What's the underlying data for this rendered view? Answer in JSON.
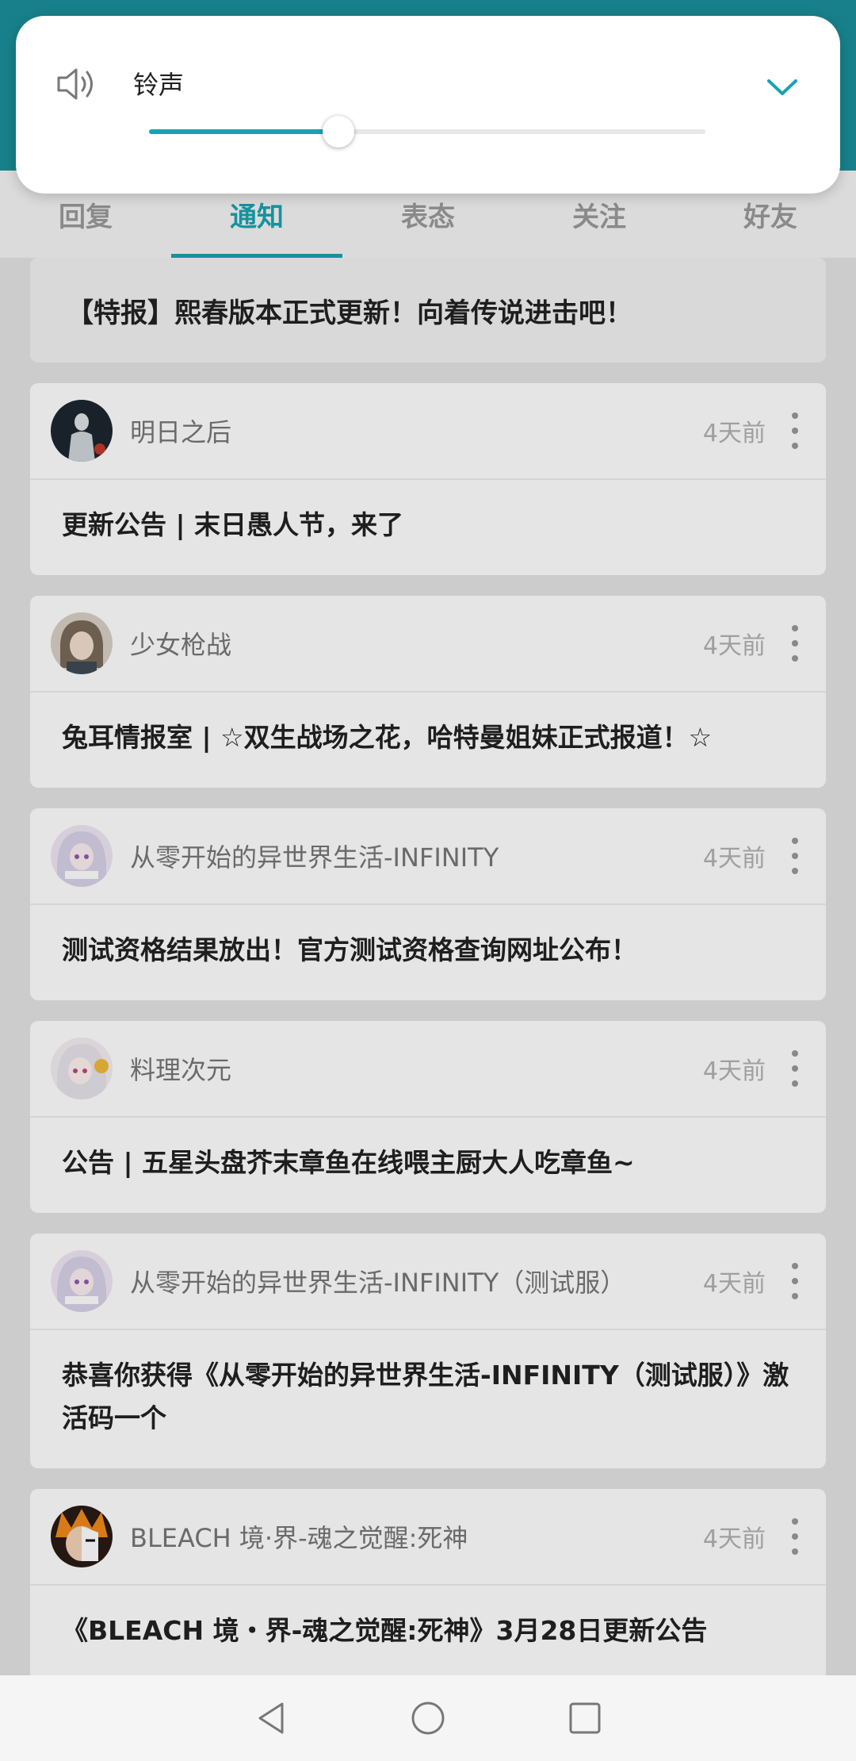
{
  "volume": {
    "label": "铃声",
    "level": 0.34,
    "accent": "#19a3b2",
    "icon": "speaker-icon",
    "expand_icon": "chevron-down-icon"
  },
  "tabs": [
    {
      "label": "回复",
      "active": false
    },
    {
      "label": "通知",
      "active": true
    },
    {
      "label": "表态",
      "active": false
    },
    {
      "label": "关注",
      "active": false
    },
    {
      "label": "好友",
      "active": false
    }
  ],
  "headline": "【特报】熙春版本正式更新！向着传说进击吧！",
  "posts": [
    {
      "author": "明日之后",
      "time": "4天前",
      "title": "更新公告 | 末日愚人节，来了"
    },
    {
      "author": "少女枪战",
      "time": "4天前",
      "title": "兔耳情报室 | ☆双生战场之花，哈特曼姐妹正式报道！☆"
    },
    {
      "author": "从零开始的异世界生活-INFINITY",
      "time": "4天前",
      "title": "测试资格结果放出！官方测试资格查询网址公布！"
    },
    {
      "author": "料理次元",
      "time": "4天前",
      "title": "公告 | 五星头盘芥末章鱼在线喂主厨大人吃章鱼~"
    },
    {
      "author": "从零开始的异世界生活-INFINITY（测试服）",
      "time": "4天前",
      "title": "恭喜你获得《从零开始的异世界生活-INFINITY（测试服）》激活码一个"
    },
    {
      "author": "BLEACH 境·界-魂之觉醒:死神",
      "time": "4天前",
      "title": "《BLEACH 境・界-魂之觉醒:死神》3月28日更新公告"
    }
  ],
  "navbar": {
    "back": "back-icon",
    "home": "home-icon",
    "recents": "recents-icon"
  }
}
